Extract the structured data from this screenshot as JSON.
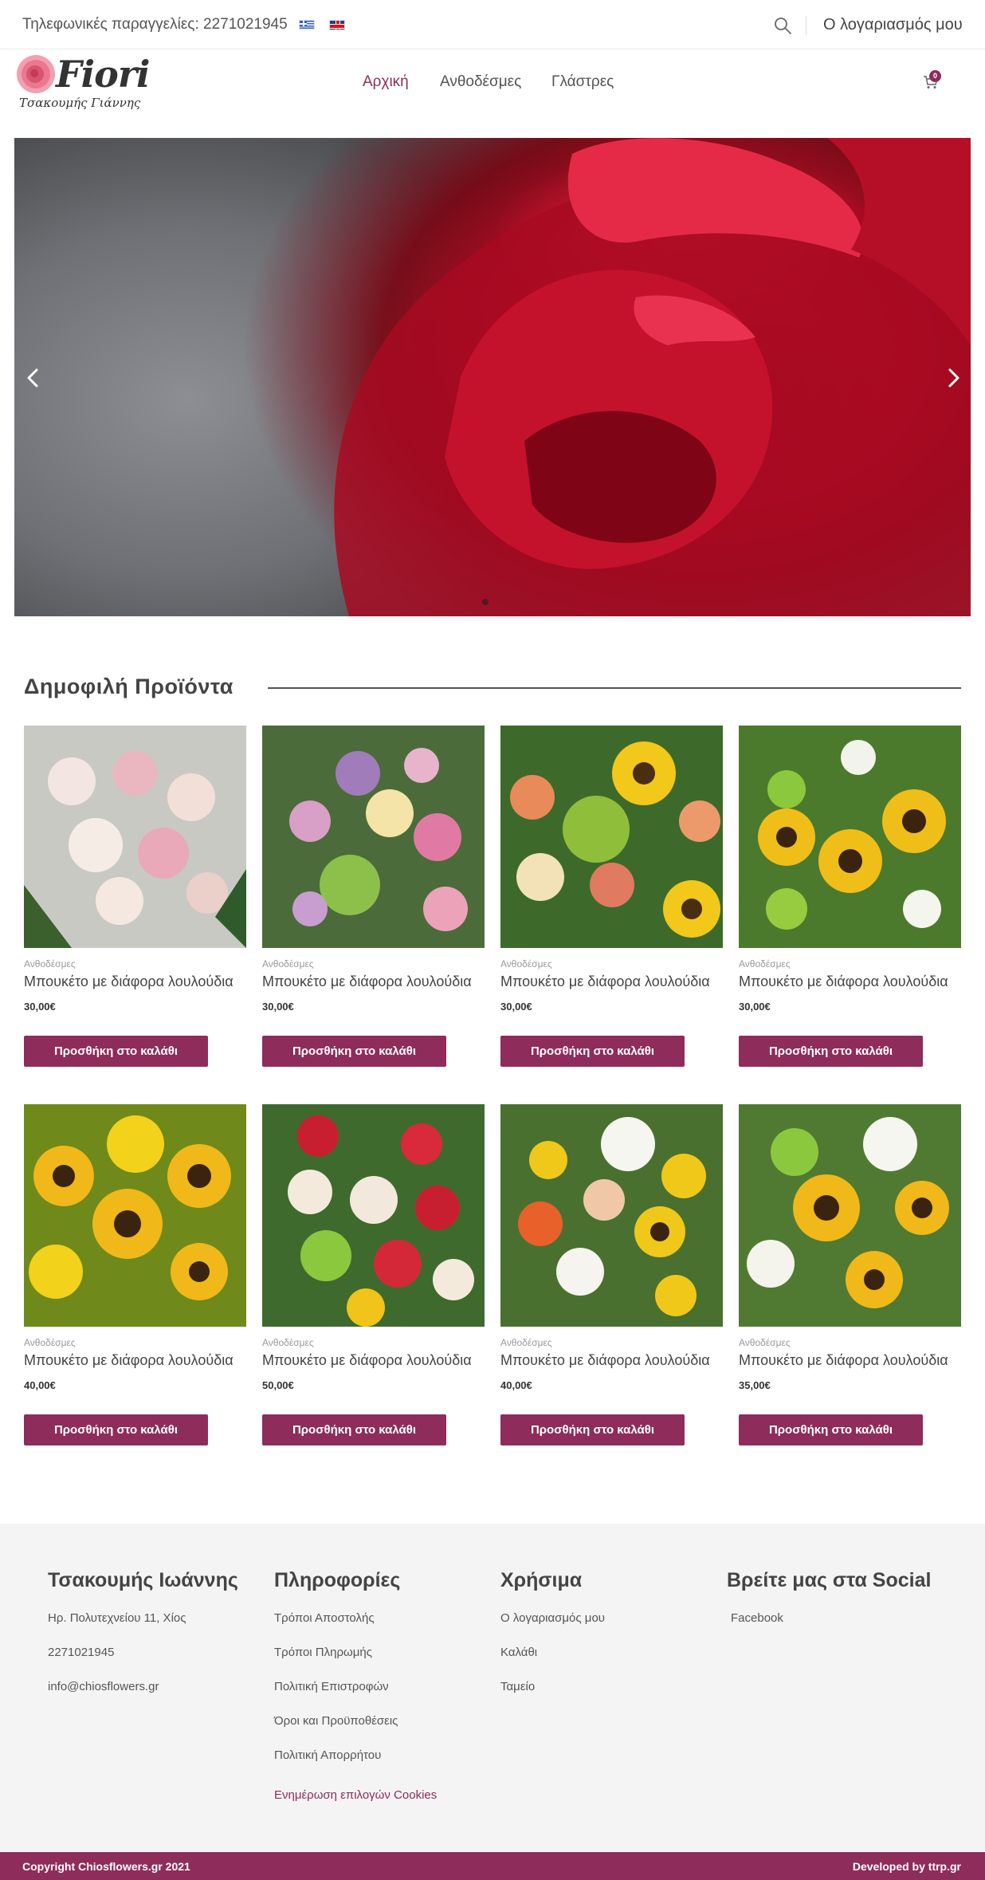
{
  "topbar": {
    "phone": "Τηλεφωνικές παραγγελίες: 2271021945",
    "account": "Ο λογαριασμός μου"
  },
  "header": {
    "logo_name": "Fiori",
    "logo_subtitle": "Τσακουμής Γιάννης",
    "nav": [
      "Αρχική",
      "Ανθοδέσμες",
      "Γλάστρες"
    ],
    "cart_count": "0"
  },
  "colors": {
    "accent": "#8e2c5b"
  },
  "popular": {
    "title": "Δημοφιλή Προϊόντα",
    "products": [
      {
        "category": "Ανθοδέσμες",
        "title": "Μπουκέτο με διάφορα λουλούδια",
        "price": "30,00€",
        "button": "Προσθήκη στο καλάθι"
      },
      {
        "category": "Ανθοδέσμες",
        "title": "Μπουκέτο με διάφορα λουλούδια",
        "price": "30,00€",
        "button": "Προσθήκη στο καλάθι"
      },
      {
        "category": "Ανθοδέσμες",
        "title": "Μπουκέτο με διάφορα λουλούδια",
        "price": "30,00€",
        "button": "Προσθήκη στο καλάθι"
      },
      {
        "category": "Ανθοδέσμες",
        "title": "Μπουκέτο με διάφορα λουλούδια",
        "price": "30,00€",
        "button": "Προσθήκη στο καλάθι"
      },
      {
        "category": "Ανθοδέσμες",
        "title": "Μπουκέτο με διάφορα λουλούδια",
        "price": "40,00€",
        "button": "Προσθήκη στο καλάθι"
      },
      {
        "category": "Ανθοδέσμες",
        "title": "Μπουκέτο με διάφορα λουλούδια",
        "price": "50,00€",
        "button": "Προσθήκη στο καλάθι"
      },
      {
        "category": "Ανθοδέσμες",
        "title": "Μπουκέτο με διάφορα λουλούδια",
        "price": "40,00€",
        "button": "Προσθήκη στο καλάθι"
      },
      {
        "category": "Ανθοδέσμες",
        "title": "Μπουκέτο με διάφορα λουλούδια",
        "price": "35,00€",
        "button": "Προσθήκη στο καλάθι"
      }
    ]
  },
  "footer": {
    "col1": {
      "title": "Τσακουμής Ιωάννης",
      "lines": [
        "Ηρ. Πολυτεχνείου 11, Χίος",
        "2271021945",
        "info@chiosflowers.gr"
      ]
    },
    "col2": {
      "title": "Πληροφορίες",
      "links": [
        "Τρόποι Αποστολής",
        "Τρόποι Πληρωμής",
        "Πολιτική Επιστροφών",
        "Όροι και Προϋποθέσεις",
        "Πολιτική Απορρήτου"
      ],
      "cookies": "Ενημέρωση επιλογών Cookies"
    },
    "col3": {
      "title": "Χρήσιμα",
      "links": [
        "Ο λογαριασμός μου",
        "Καλάθι",
        "Ταμείο"
      ]
    },
    "col4": {
      "title": "Βρείτε μας στα Social",
      "links": [
        "Facebook"
      ]
    }
  },
  "bottombar": {
    "copyright": "Copyright Chiosflowers.gr 2021",
    "developer": "Developed by ttrp.gr"
  }
}
